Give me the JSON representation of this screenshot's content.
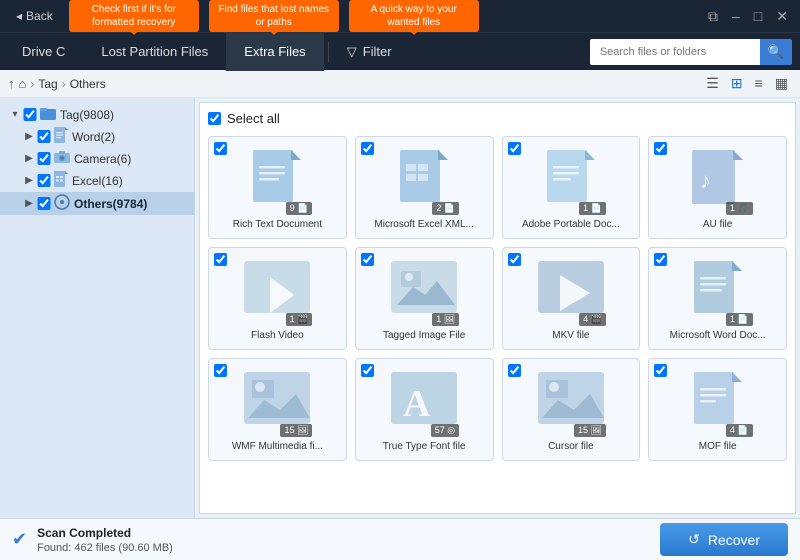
{
  "titleBar": {
    "back_label": "Back",
    "tooltip1": "Check first if it's for formatted recovery",
    "tooltip2": "Find files that lost names or paths",
    "tooltip3": "A quick way to your wanted files",
    "controls": [
      "⧉",
      "–",
      "□",
      "✕"
    ]
  },
  "navBar": {
    "tabs": [
      {
        "label": "Drive C",
        "active": false
      },
      {
        "label": "Lost Partition Files",
        "active": false
      },
      {
        "label": "Extra Files",
        "active": true
      },
      {
        "label": "Filter",
        "active": false
      }
    ],
    "search_placeholder": "Search files or folders"
  },
  "breadcrumb": {
    "items": [
      "↑",
      "⌂",
      "Tag",
      "Others"
    ]
  },
  "sidebar": {
    "tree": [
      {
        "level": 1,
        "label": "Tag(9808)",
        "checked": true,
        "icon": "📁",
        "expanded": true,
        "selected": false
      },
      {
        "level": 2,
        "label": "Word(2)",
        "checked": true,
        "icon": "📄",
        "expanded": false,
        "selected": false
      },
      {
        "level": 2,
        "label": "Camera(6)",
        "checked": true,
        "icon": "🖼",
        "expanded": false,
        "selected": false
      },
      {
        "level": 2,
        "label": "Excel(16)",
        "checked": true,
        "icon": "📊",
        "expanded": false,
        "selected": false
      },
      {
        "level": 2,
        "label": "Others(9784)",
        "checked": true,
        "icon": "◎",
        "expanded": false,
        "selected": true
      }
    ]
  },
  "content": {
    "select_all": "Select all",
    "files": [
      {
        "name": "Rich Text Document",
        "count": 9,
        "type": "doc",
        "icon": "doc",
        "checked": true
      },
      {
        "name": "Microsoft Excel XML...",
        "count": 2,
        "type": "doc",
        "icon": "doc",
        "checked": true
      },
      {
        "name": "Adobe Portable Doc...",
        "count": 1,
        "type": "doc",
        "icon": "doc",
        "checked": true
      },
      {
        "name": "AU file",
        "count": 1,
        "type": "audio",
        "icon": "audio",
        "checked": true
      },
      {
        "name": "Flash Video",
        "count": 1,
        "type": "video",
        "icon": "video",
        "checked": true
      },
      {
        "name": "Tagged Image File",
        "count": 1,
        "type": "img",
        "icon": "img",
        "checked": true
      },
      {
        "name": "MKV file",
        "count": 4,
        "type": "video",
        "icon": "video",
        "checked": true
      },
      {
        "name": "Microsoft Word Doc...",
        "count": 1,
        "type": "doc",
        "icon": "doc",
        "checked": true
      },
      {
        "name": "WMF Multimedia fi...",
        "count": 15,
        "type": "img",
        "icon": "img",
        "checked": true
      },
      {
        "name": "True Type Font file",
        "count": 57,
        "type": "font",
        "icon": "font",
        "checked": true
      },
      {
        "name": "Cursor file",
        "count": 15,
        "type": "img",
        "icon": "img",
        "checked": true
      },
      {
        "name": "MOF file",
        "count": 4,
        "type": "doc",
        "icon": "doc",
        "checked": true
      }
    ]
  },
  "statusBar": {
    "status": "Scan Completed",
    "detail": "Found: 462 files (90.60 MB)",
    "recover_label": "Recover"
  }
}
